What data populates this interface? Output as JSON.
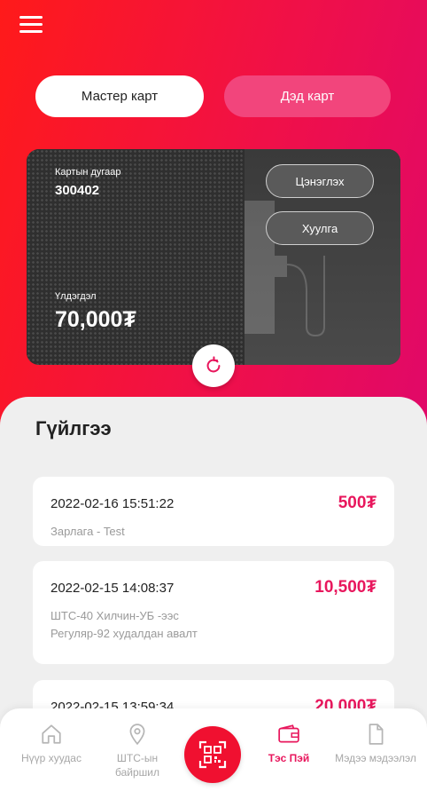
{
  "header": {
    "menu_icon": "hamburger-menu-icon"
  },
  "card_toggle": {
    "master_label": "Мастер карт",
    "sub_label": "Дэд карт"
  },
  "card": {
    "number_label": "Картын дугаар",
    "number": "300402",
    "balance_label": "Үлдэгдэл",
    "balance": "70,000₮",
    "topup_label": "Цэнэглэх",
    "transfer_label": "Хуулга",
    "refresh_icon": "refresh-icon"
  },
  "transactions": {
    "title": "Гүйлгээ",
    "items": [
      {
        "date": "2022-02-16 15:51:22",
        "amount": "500₮",
        "description": "Зарлага - Test"
      },
      {
        "date": "2022-02-15 14:08:37",
        "amount": "10,500₮",
        "description": "ШТС-40 Хилчин-УБ -ээс Регуляр-92 худалдан авалт"
      },
      {
        "date": "2022-02-15 13:59:34",
        "amount": "20,000₮",
        "description": ""
      }
    ]
  },
  "nav": {
    "home": "Нүүр хуудас",
    "stations": "ШТС-ын байршил",
    "pay": "Тэс Пэй",
    "info": "Мэдээ мэдээлэл"
  },
  "colors": {
    "accent": "#e8175d",
    "gradient_start": "#ff1a1a",
    "gradient_end": "#e0086a"
  }
}
